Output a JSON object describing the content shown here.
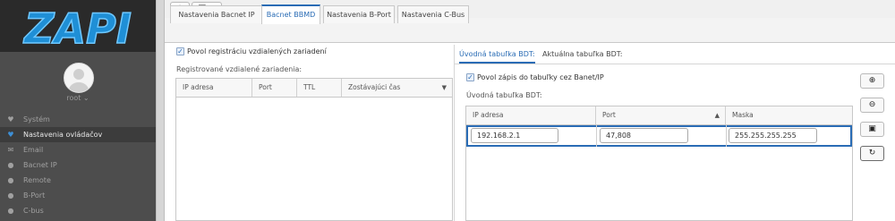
{
  "sidebar": {
    "logo_text": "ZAPI",
    "username": "root ⌄",
    "items": [
      {
        "label": "Systém",
        "icon": "heart-icon",
        "glyph": "♥",
        "active": false
      },
      {
        "label": "Nastavenia ovládačov",
        "icon": "heart-icon",
        "glyph": "♥",
        "active": true
      },
      {
        "label": "Email",
        "icon": "envelope-icon",
        "glyph": "✉",
        "active": false
      },
      {
        "label": "Bacnet IP",
        "icon": "globe-icon",
        "glyph": "●",
        "active": false
      },
      {
        "label": "Remote",
        "icon": "globe-icon",
        "glyph": "●",
        "active": false
      },
      {
        "label": "B-Port",
        "icon": "globe-icon",
        "glyph": "●",
        "active": false
      },
      {
        "label": "C-bus",
        "icon": "globe-icon",
        "glyph": "●",
        "active": false
      }
    ]
  },
  "toolbar": {
    "btn1_glyph": "⌖",
    "btn2_glyph": "▣ ⌄"
  },
  "tabs": [
    {
      "label": "Nastavenia Bacnet IP"
    },
    {
      "label": "Bacnet BBMD"
    },
    {
      "label": "Nastavenia B-Port"
    },
    {
      "label": "Nastavenia C-Bus"
    }
  ],
  "left": {
    "checkbox_label": "Povol registráciu vzdialených zariadení",
    "section_label": "Registrované vzdialené zariadenia:",
    "columns": [
      "IP adresa",
      "Port",
      "TTL",
      "Zostávajúci čas"
    ]
  },
  "right": {
    "subtabs": [
      "Úvodná tabuľka BDT:",
      "Aktuálna tabuľka BDT:"
    ],
    "checkbox_label": "Povol zápis do tabuľky cez Banet/IP",
    "section_label": "Úvodná tabuľka BDT:",
    "columns": [
      "IP adresa",
      "Port",
      "Maska"
    ],
    "row": {
      "ip": "192.168.2.1",
      "port": "47,808",
      "mask": "255.255.255.255"
    },
    "buttons": [
      "⊕",
      "⊖",
      "▣",
      "↻"
    ]
  }
}
